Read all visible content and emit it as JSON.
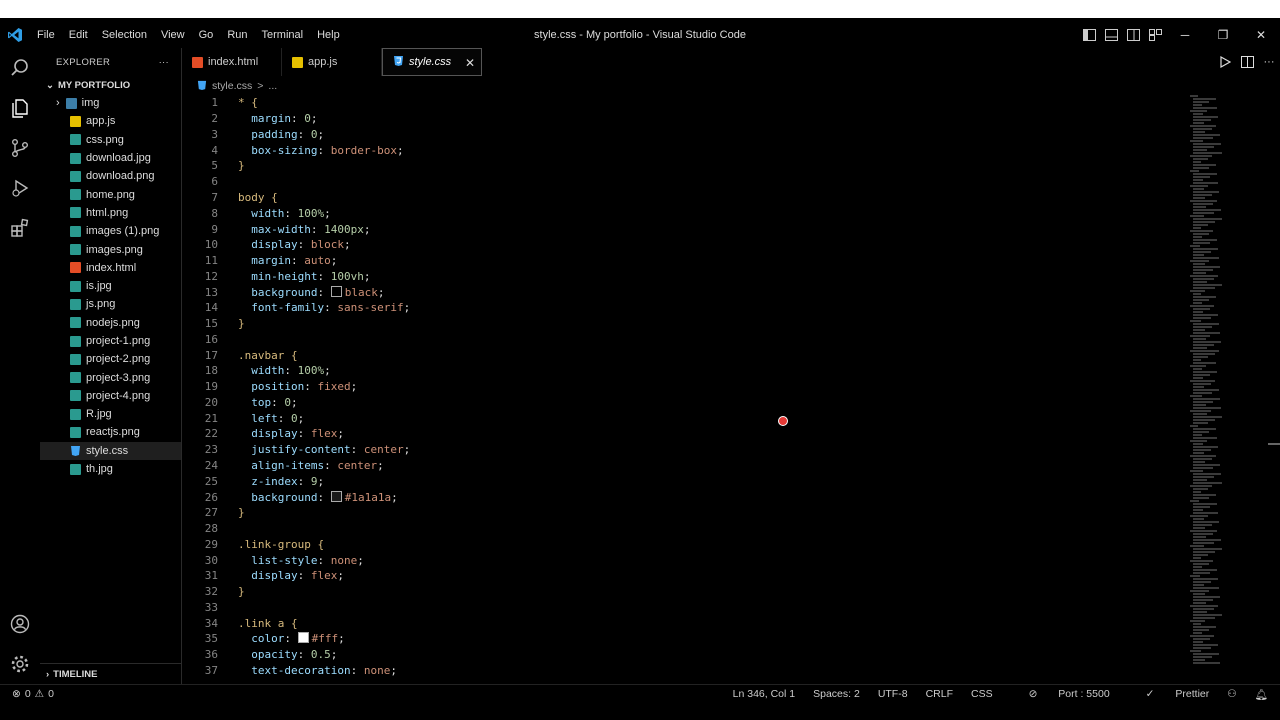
{
  "window": {
    "title": "style.css - My portfolio - Visual Studio Code",
    "menu": [
      "File",
      "Edit",
      "Selection",
      "View",
      "Go",
      "Run",
      "Terminal",
      "Help"
    ]
  },
  "sidebar": {
    "header": "EXPLORER",
    "more": "···",
    "folder": "MY PORTFOLIO",
    "items": [
      {
        "label": "img",
        "type": "folder"
      },
      {
        "label": "app.js",
        "type": "js"
      },
      {
        "label": "css.png",
        "type": "img"
      },
      {
        "label": "download.jpg",
        "type": "img"
      },
      {
        "label": "download.png",
        "type": "img"
      },
      {
        "label": "home.png",
        "type": "img"
      },
      {
        "label": "html.png",
        "type": "img"
      },
      {
        "label": "images (1).png",
        "type": "img"
      },
      {
        "label": "images.png",
        "type": "img"
      },
      {
        "label": "index.html",
        "type": "html"
      },
      {
        "label": "is.jpg",
        "type": "img"
      },
      {
        "label": "js.png",
        "type": "img"
      },
      {
        "label": "nodejs.png",
        "type": "img"
      },
      {
        "label": "project-1.png",
        "type": "img"
      },
      {
        "label": "project-2.png",
        "type": "img"
      },
      {
        "label": "project-3.png",
        "type": "img"
      },
      {
        "label": "project-4.png",
        "type": "img"
      },
      {
        "label": "R.jpg",
        "type": "img"
      },
      {
        "label": "reactjs.png",
        "type": "img"
      },
      {
        "label": "style.css",
        "type": "css"
      },
      {
        "label": "th.jpg",
        "type": "img"
      }
    ],
    "timeline": "TIMELINE"
  },
  "tabs": [
    {
      "label": "index.html",
      "type": "html"
    },
    {
      "label": "app.js",
      "type": "js"
    },
    {
      "label": "style.css",
      "type": "css"
    }
  ],
  "breadcrumb": {
    "file": "style.css",
    "sep": ">",
    "rest": "..."
  },
  "code_lines": [
    "* {",
    "  margin: 0;",
    "  padding: 0;",
    "  box-sizing: border-box;",
    "}",
    "",
    "body {",
    "  width: 100%;",
    "  max-width: 1400px;",
    "  display: block;",
    "  margin: auto;",
    "  min-height: 100vh;",
    "  background: black;",
    "  font-family: sans-serif;",
    "}",
    "",
    ".navbar {",
    "  width: 100%;",
    "  position: fixed;",
    "  top: 0;",
    "  left: 0;",
    "  display: flex;",
    "  justify-content: center;",
    "  align-items: center;",
    "  z-index: 9;",
    "  background: #1a1a1a;",
    "}",
    "",
    ".link-group {",
    "  list-style: none;",
    "  display: flex;",
    "}",
    "",
    ".link a {",
    "  color: #fff;",
    "  opacity: 0.5;",
    "  text-decoration: none;"
  ],
  "statusbar": {
    "errors": "0",
    "warnings": "0",
    "position": "Ln 346, Col 1",
    "spaces": "Spaces: 2",
    "encoding": "UTF-8",
    "eol": "CRLF",
    "language": "CSS",
    "port": "Port : 5500",
    "prettier": "Prettier"
  },
  "colors": {
    "css_icon": "#42a5f5",
    "js_icon": "#e6c000",
    "html_icon": "#e44d26",
    "img_icon": "#2a9a8f"
  }
}
